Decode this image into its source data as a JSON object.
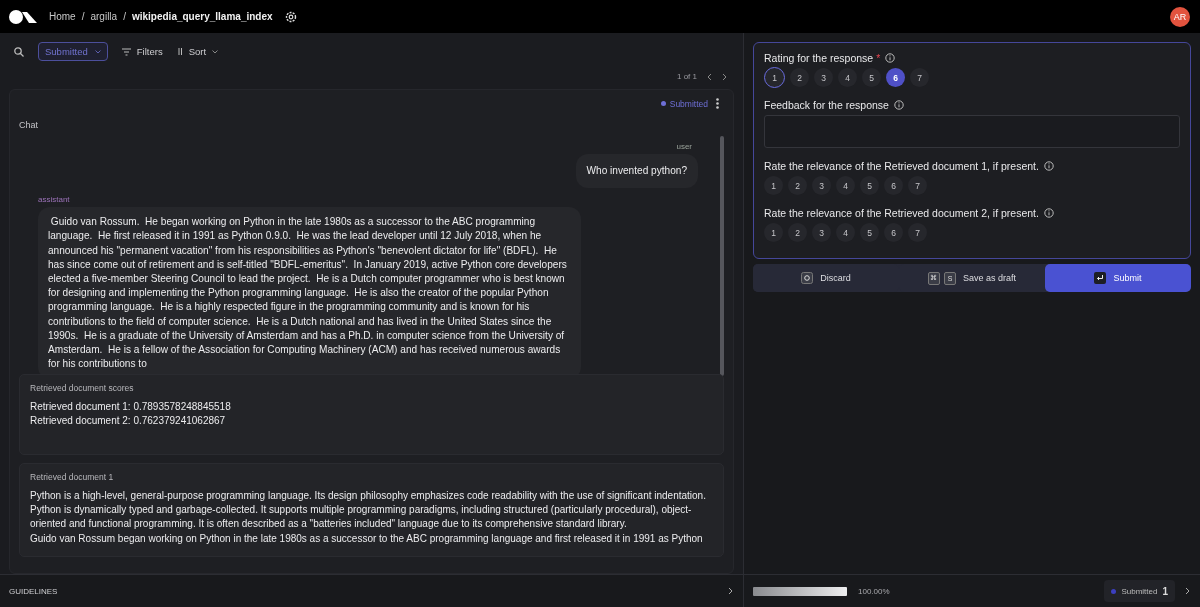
{
  "topbar": {
    "breadcrumbs": [
      {
        "label": "Home",
        "current": false
      },
      {
        "separator": "/",
        "label": "argilla",
        "current": false
      },
      {
        "separator": "/",
        "label": "wikipedia_query_llama_index",
        "current": true
      }
    ],
    "avatar": "AR"
  },
  "toolbar": {
    "status_filter": "Submitted",
    "filters": "Filters",
    "sort": "Sort"
  },
  "pagination": "1 of 1",
  "record": {
    "status": "Submitted",
    "fields": [
      {
        "kind": "chat",
        "title": "Chat",
        "messages": [
          {
            "kind": "user",
            "role": "user",
            "text": "Who invented python?"
          },
          {
            "kind": "assistant",
            "role": "assistant",
            "text": " Guido van Rossum.  He began working on Python in the late 1980s as a successor to the ABC programming language.  He first released it in 1991 as Python 0.9.0.  He was the lead developer until 12 July 2018, when he announced his \"permanent vacation\" from his responsibilities as Python's \"benevolent dictator for life\" (BDFL).  He has since come out of retirement and is self-titled \"BDFL-emeritus\".  In January 2019, active Python core developers elected a five-member Steering Council to lead the project.  He is a Dutch computer programmer who is best known for designing and implementing the Python programming language.  He is also the creator of the popular Python programming language.  He is a highly respected figure in the programming community and is known for his contributions to the field of computer science.  He is a Dutch national and has lived in the United States since the 1990s.  He is a graduate of the University of Amsterdam and has a Ph.D. in computer science from the University of Amsterdam.  He is a fellow of the Association for Computing Machinery (ACM) and has received numerous awards for his contributions to"
          }
        ]
      },
      {
        "kind": "text",
        "title": "Retrieved document scores",
        "lines": [
          "Retrieved document 1: 0.7893578248845518",
          "Retrieved document 2: 0.762379241062867"
        ]
      },
      {
        "kind": "text",
        "title": "Retrieved document 1",
        "lines": [
          "Python is a high-level, general-purpose programming language. Its design philosophy emphasizes code readability with the use of significant indentation.",
          "Python is dynamically typed and garbage-collected. It supports multiple programming paradigms, including structured (particularly procedural), object-oriented and functional programming. It is often described as a \"batteries included\" language due to its comprehensive standard library.",
          "Guido van Rossum began working on Python in the late 1980s as a successor to the ABC programming language and first released it in 1991 as Python"
        ]
      }
    ]
  },
  "guidelines": "GUIDELINES",
  "questions": [
    {
      "kind": "rating",
      "title": "Rating for the response",
      "required_mark": "*",
      "options": [
        {
          "label": "1",
          "selected": false,
          "focused": true
        },
        {
          "label": "2",
          "selected": false,
          "focused": false
        },
        {
          "label": "3",
          "selected": false,
          "focused": false
        },
        {
          "label": "4",
          "selected": false,
          "focused": false
        },
        {
          "label": "5",
          "selected": false,
          "focused": false
        },
        {
          "label": "6",
          "selected": true,
          "focused": false
        },
        {
          "label": "7",
          "selected": false,
          "focused": false
        }
      ]
    },
    {
      "kind": "text",
      "title": "Feedback for the response"
    },
    {
      "kind": "rating",
      "title": "Rate the relevance of the Retrieved document 1, if present.",
      "options": [
        {
          "label": "1",
          "selected": false,
          "focused": false
        },
        {
          "label": "2",
          "selected": false,
          "focused": false
        },
        {
          "label": "3",
          "selected": false,
          "focused": false
        },
        {
          "label": "4",
          "selected": false,
          "focused": false
        },
        {
          "label": "5",
          "selected": false,
          "focused": false
        },
        {
          "label": "6",
          "selected": false,
          "focused": false
        },
        {
          "label": "7",
          "selected": false,
          "focused": false
        }
      ]
    },
    {
      "kind": "rating",
      "title": "Rate the relevance of the Retrieved document 2, if present.",
      "options": [
        {
          "label": "1",
          "selected": false,
          "focused": false
        },
        {
          "label": "2",
          "selected": false,
          "focused": false
        },
        {
          "label": "3",
          "selected": false,
          "focused": false
        },
        {
          "label": "4",
          "selected": false,
          "focused": false
        },
        {
          "label": "5",
          "selected": false,
          "focused": false
        },
        {
          "label": "6",
          "selected": false,
          "focused": false
        },
        {
          "label": "7",
          "selected": false,
          "focused": false
        }
      ]
    }
  ],
  "actions": [
    {
      "kind": "discard",
      "label": "Discard"
    },
    {
      "kind": "draft",
      "label": "Save as draft",
      "keys": [
        "⌘",
        "S"
      ]
    },
    {
      "kind": "submit",
      "label": "Submit"
    }
  ],
  "footer": {
    "progress": {
      "level": 1,
      "reading": "100.00%"
    },
    "status": "Submitted",
    "count": "1"
  }
}
